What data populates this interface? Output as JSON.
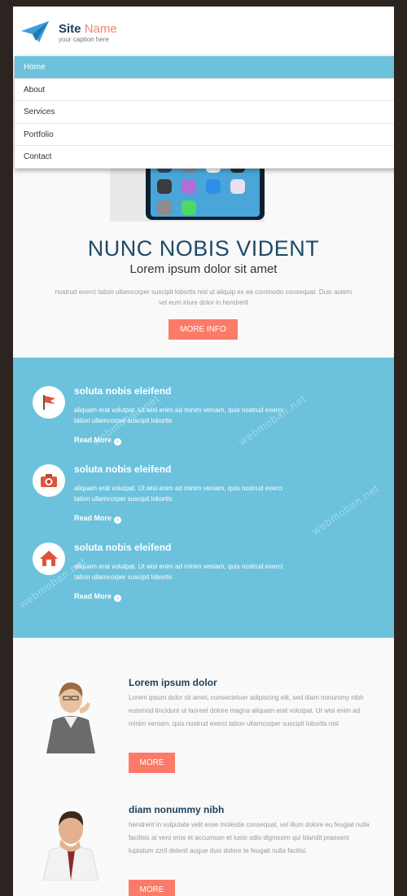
{
  "header": {
    "site_name_bold": "Site",
    "site_name_accent": "Name",
    "caption": "your caption here"
  },
  "nav": {
    "items": [
      {
        "label": "Home"
      },
      {
        "label": "About"
      },
      {
        "label": "Services"
      },
      {
        "label": "Portfolio"
      },
      {
        "label": "Contact"
      }
    ]
  },
  "hero": {
    "title": "NUNC NOBIS VIDENT",
    "subtitle": "Lorem ipsum dolor sit amet",
    "text": "nostrud exerci tation ullamcorper suscipit lobortis nisl ut aliquip ex ea commodo consequat. Duis autem vel eum iriure dolor in hendrerit",
    "button_label": "MORE INFO"
  },
  "features": [
    {
      "icon": "flag-icon",
      "title": "soluta nobis eleifend",
      "text": "aliquam erat volutpat. Ut wisi enim ad minim veniam, quis nostrud exerci tation ullamcorper suscipit lobortis",
      "link": "Read More"
    },
    {
      "icon": "camera-icon",
      "title": "soluta nobis eleifend",
      "text": "aliquam erat volutpat. Ut wisi enim ad minim veniam, quis nostrud exerci tation ullamcorper suscipit lobortis",
      "link": "Read More"
    },
    {
      "icon": "home-icon",
      "title": "soluta nobis eleifend",
      "text": "aliquam erat volutpat. Ut wisi enim ad minim veniam, quis nostrud exerci tation ullamcorper suscipit lobortis",
      "link": "Read More"
    }
  ],
  "articles": [
    {
      "title": "Lorem ipsum dolor",
      "text": "Lorem ipsum dolor sit amet, consectetuer adipiscing elit, sed diam nonummy nibh euismod tincidunt ut laoreet dolore magna aliquam erat volutpat. Ut wisi enim ad minim veniam, quis nostrud exerci tation ullamcorper suscipit lobortis nisl",
      "button_label": "MORE"
    },
    {
      "title": "diam nonummy nibh",
      "text": "hendrerit in vulputate velit esse molestie consequat, vel illum dolore eu feugiat nulla facilisis at vero eros et accumsan et iusto odio dignissim qui blandit praesent luptatum zzril delenit augue duis dolore te feugait nulla facilisi.",
      "button_label": "MORE"
    }
  ],
  "watermark": "webmoban.net",
  "colors": {
    "accent_blue": "#6cc2dd",
    "button_coral": "#fb7b68",
    "title_navy": "#1e4a66"
  }
}
